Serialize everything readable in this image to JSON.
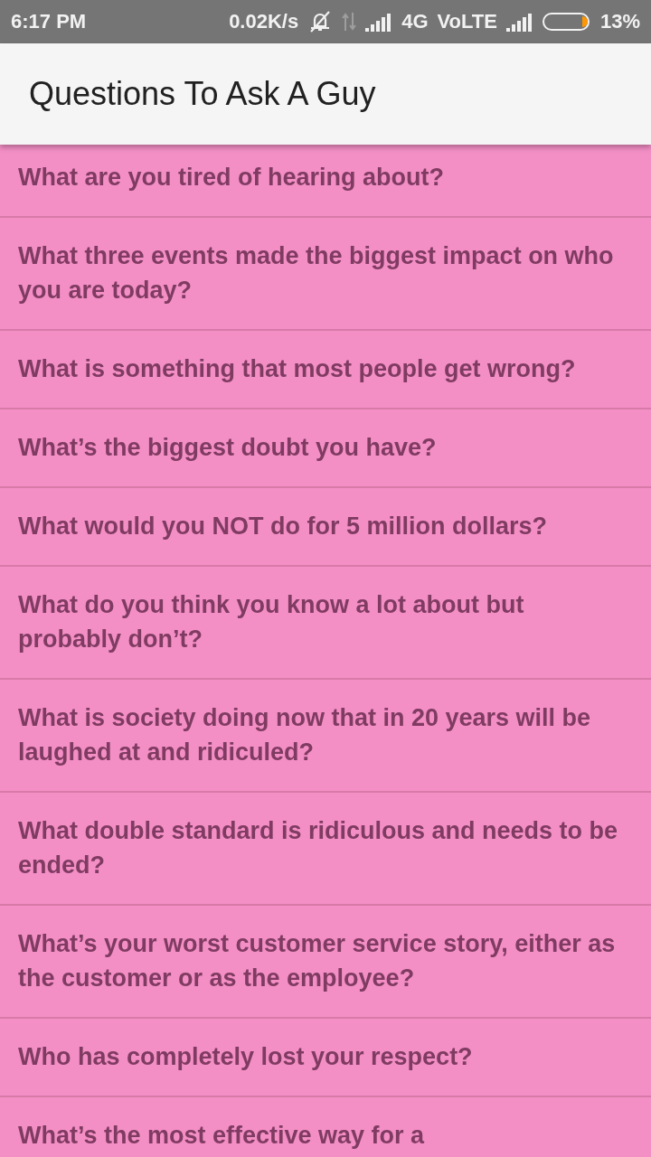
{
  "status_bar": {
    "time": "6:17 PM",
    "speed": "0.02K/s",
    "network": "4G",
    "volte": "VoLTE",
    "battery": "13%"
  },
  "app_bar": {
    "title": "Questions To Ask A Guy"
  },
  "questions": [
    "What are you tired of hearing about?",
    "What three events made the biggest impact on who you are today?",
    "What is something that most people get wrong?",
    "What’s the biggest doubt you have?",
    "What would you NOT do for 5 million dollars?",
    "What do you think you know a lot about but probably don’t?",
    "What is society doing now that in 20 years will be laughed at and ridiculed?",
    "What double standard is ridiculous and needs to be ended?",
    "What’s your worst customer service story, either as the customer or as the employee?",
    "Who has completely lost your respect?",
    "What’s the most effective way for a"
  ]
}
